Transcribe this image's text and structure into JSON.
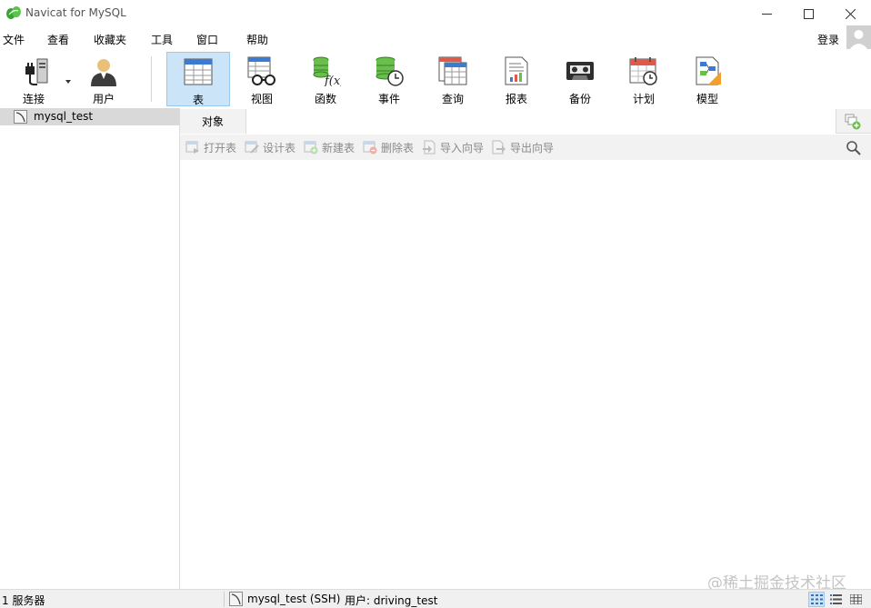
{
  "window": {
    "title": "Navicat for MySQL"
  },
  "menu": {
    "items": [
      {
        "label": "文件",
        "name": "menu-file"
      },
      {
        "label": "查看",
        "name": "menu-view"
      },
      {
        "label": "收藏夹",
        "name": "menu-favorites"
      },
      {
        "label": "工具",
        "name": "menu-tools"
      },
      {
        "label": "窗口",
        "name": "menu-window"
      },
      {
        "label": "帮助",
        "name": "menu-help"
      }
    ],
    "login_label": "登录"
  },
  "toolbar": {
    "connect": "连接",
    "user": "用户",
    "table": "表",
    "view": "视图",
    "function": "函数",
    "event": "事件",
    "query": "查询",
    "report": "报表",
    "backup": "备份",
    "schedule": "计划",
    "model": "模型",
    "active_tool": "表"
  },
  "connections": [
    {
      "label": "mysql_test"
    }
  ],
  "tabs": {
    "objects_label": "对象"
  },
  "object_toolbar": {
    "open_table": "打开表",
    "design_table": "设计表",
    "new_table": "新建表",
    "delete_table": "删除表",
    "import_wizard": "导入向导",
    "export_wizard": "导出向导"
  },
  "status": {
    "servers": "1 服务器",
    "connection": "mysql_test (SSH)",
    "user": "用户: driving_test"
  },
  "watermark": "@稀土掘金技术社区",
  "colors": {
    "accent": "#cce4f7",
    "selection": "#d9d9d9",
    "logo": "#3aa335"
  }
}
